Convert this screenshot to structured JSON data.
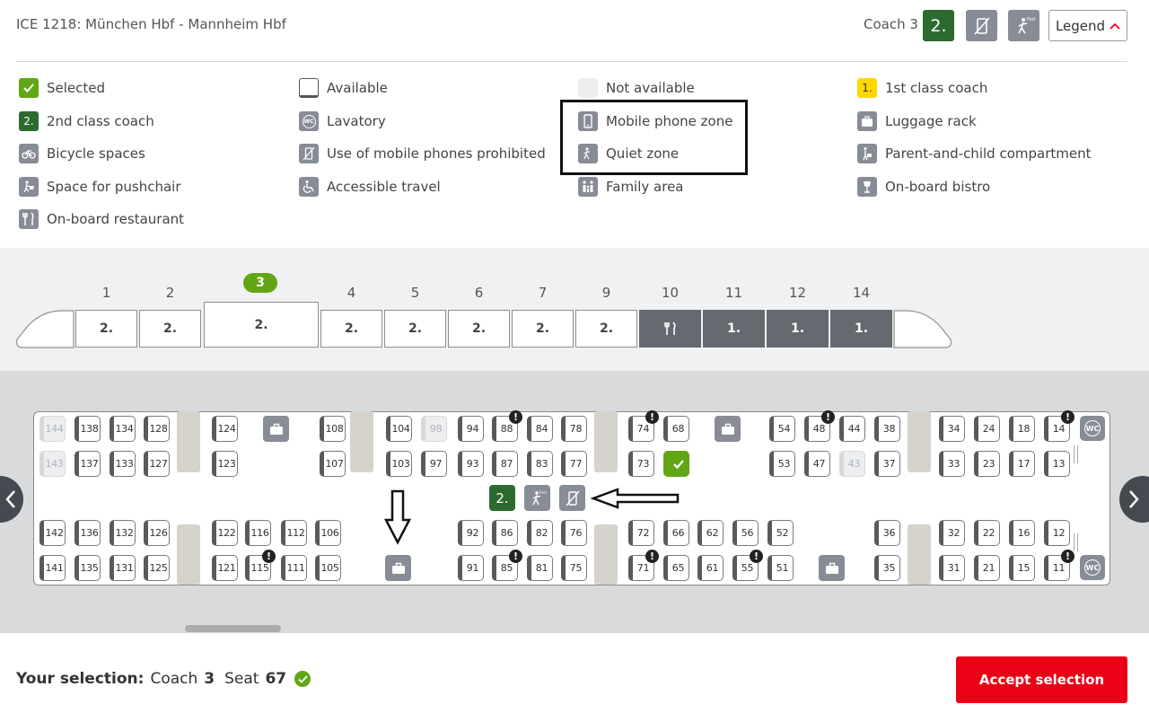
{
  "header": {
    "route": "ICE 1218: München Hbf - Mannheim Hbf",
    "coach_label": "Coach 3",
    "class_badge": "2.",
    "legend_button": "Legend"
  },
  "colors": {
    "green": "#63a615",
    "dark_green": "#2d6a2f",
    "gray": "#878c96",
    "yellow": "#ffd800",
    "red": "#ec0016"
  },
  "legend": {
    "col1": [
      "Selected",
      "2nd class coach",
      "Bicycle spaces",
      "Space for pushchair",
      "On-board restaurant"
    ],
    "col2": [
      "Available",
      "Lavatory",
      "Use of mobile phones prohibited",
      "Accessible travel"
    ],
    "col3": [
      "Not available",
      "Mobile phone zone",
      "Quiet zone",
      "Family area"
    ],
    "col4": [
      "1st class coach",
      "Luggage rack",
      "Parent-and-child compartment",
      "On-board bistro"
    ],
    "badge_2nd": "2.",
    "badge_1st": "1.",
    "lavatory_abbr": "WC"
  },
  "train": {
    "selected_coach": "3",
    "coaches": [
      {
        "num": "1",
        "label": "2."
      },
      {
        "num": "2",
        "label": "2."
      },
      {
        "num": "3",
        "label": "2."
      },
      {
        "num": "4",
        "label": "2."
      },
      {
        "num": "5",
        "label": "2."
      },
      {
        "num": "6",
        "label": "2."
      },
      {
        "num": "7",
        "label": "2."
      },
      {
        "num": "9",
        "label": "2."
      },
      {
        "num": "10",
        "label": ""
      },
      {
        "num": "11",
        "label": "1."
      },
      {
        "num": "12",
        "label": "1."
      },
      {
        "num": "14",
        "label": "1."
      }
    ]
  },
  "seatmap": {
    "wc": "WC",
    "zone_badge": "2.",
    "row1": [
      "144",
      "138",
      "134",
      "128",
      "124",
      "108",
      "104",
      "98",
      "94",
      "88",
      "84",
      "78",
      "74",
      "68",
      "54",
      "48",
      "44",
      "38",
      "34",
      "24",
      "18",
      "14"
    ],
    "row2": [
      "143",
      "137",
      "133",
      "127",
      "123",
      "107",
      "103",
      "97",
      "93",
      "87",
      "83",
      "77",
      "73",
      "53",
      "47",
      "43",
      "37",
      "33",
      "23",
      "17",
      "13"
    ],
    "row3": [
      "142",
      "136",
      "132",
      "126",
      "122",
      "116",
      "112",
      "106",
      "92",
      "86",
      "82",
      "76",
      "72",
      "66",
      "62",
      "56",
      "52",
      "36",
      "32",
      "22",
      "16",
      "12"
    ],
    "row4": [
      "141",
      "135",
      "131",
      "125",
      "121",
      "115",
      "111",
      "105",
      "91",
      "85",
      "81",
      "75",
      "71",
      "65",
      "61",
      "55",
      "51",
      "35",
      "31",
      "21",
      "15",
      "11"
    ],
    "warn": "!"
  },
  "footer": {
    "your_selection": "Your selection:",
    "coach_word": "Coach",
    "coach_num": "3",
    "seat_word": "Seat",
    "seat_num": "67",
    "accept": "Accept selection"
  }
}
